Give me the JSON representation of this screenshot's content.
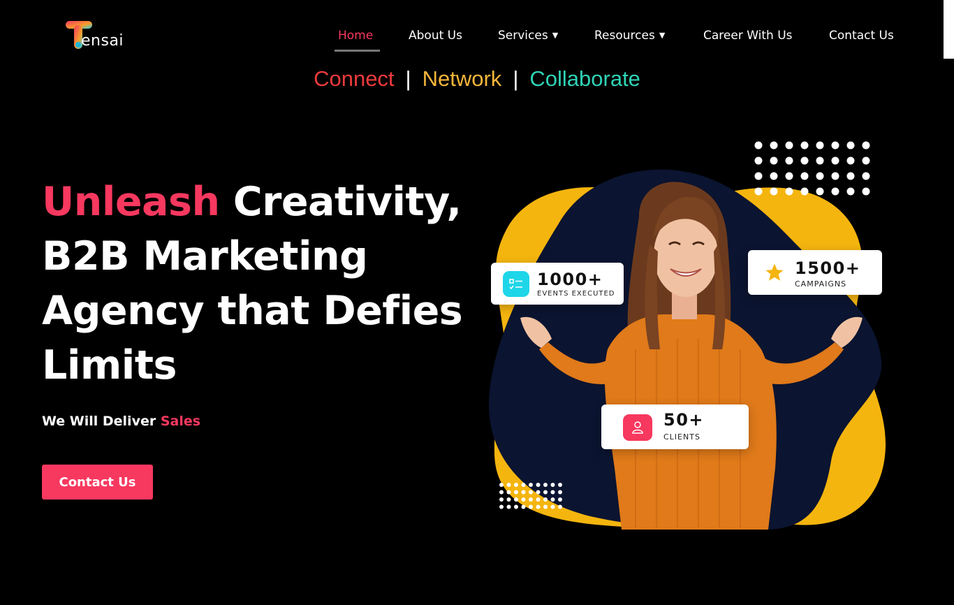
{
  "brand": {
    "logo_text": "ensai"
  },
  "nav": {
    "items": [
      {
        "label": "Home",
        "active": true
      },
      {
        "label": "About Us"
      },
      {
        "label": "Services",
        "dropdown": true
      },
      {
        "label": "Resources",
        "dropdown": true
      },
      {
        "label": "Career With Us"
      },
      {
        "label": "Contact Us"
      }
    ]
  },
  "tagline": {
    "parts": [
      "Connect",
      "Network",
      "Collaborate"
    ],
    "separator": "|"
  },
  "hero": {
    "title_accent": "Unleash",
    "title_line1_rest": " Creativity,",
    "title_line2": "B2B Marketing",
    "title_line3": "Agency that Defies",
    "title_line4": "Limits",
    "subtitle_prefix": "We Will Deliver ",
    "subtitle_accent": "Sales",
    "cta_label": "Contact Us"
  },
  "stats": [
    {
      "value": "1000+",
      "label": "EVENTS EXECUTED",
      "icon": "checklist-icon"
    },
    {
      "value": "1500+",
      "label": "CAMPAIGNS",
      "icon": "star-icon"
    },
    {
      "value": "50+",
      "label": "CLIENTS",
      "icon": "user-icon"
    }
  ],
  "colors": {
    "accent_pink": "#f7385f",
    "tag_red": "#ec3b3d",
    "tag_yellow": "#f5b63a",
    "tag_teal": "#2fd3b6",
    "blob_yellow": "#f5b50f",
    "blob_navy": "#0b1430",
    "icon_cyan": "#1fd6e8"
  }
}
